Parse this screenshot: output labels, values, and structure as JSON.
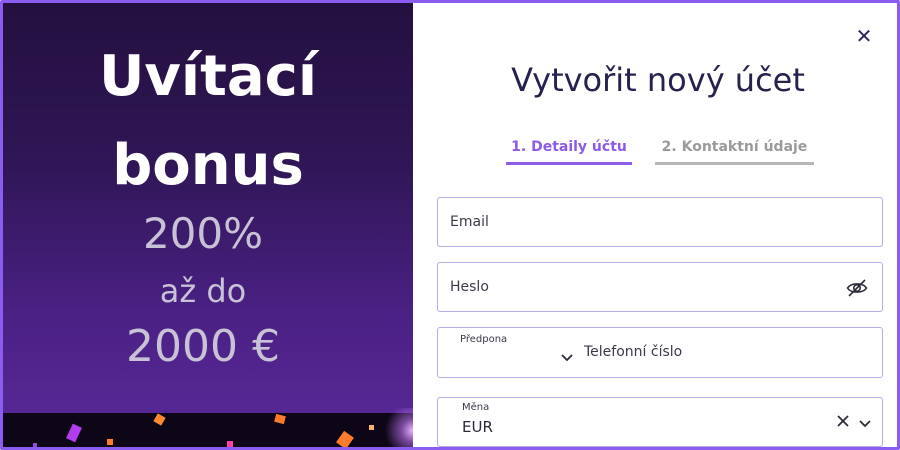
{
  "promo": {
    "title_line1": "Uvítací",
    "title_line2": "bonus",
    "percent": "200%",
    "upto": "až do",
    "amount": "2000 €"
  },
  "modal": {
    "title": "Vytvořit nový účet",
    "close_icon": "close-icon"
  },
  "tabs": [
    {
      "label": "1. Detaily účtu",
      "active": true
    },
    {
      "label": "2. Kontaktní údaje",
      "active": false
    }
  ],
  "form": {
    "email_placeholder": "Email",
    "password_placeholder": "Heslo",
    "password_icon": "eye-off-icon",
    "prefix_label": "Předpona",
    "prefix_value": "",
    "phone_placeholder": "Telefonní číslo",
    "currency_label": "Měna",
    "currency_value": "EUR"
  },
  "colors": {
    "accent": "#8e5ae8",
    "border": "#8a5cf0",
    "title": "#25224f",
    "promo_bg_top": "#24103f",
    "promo_bg_bottom": "#5a2a9a"
  }
}
